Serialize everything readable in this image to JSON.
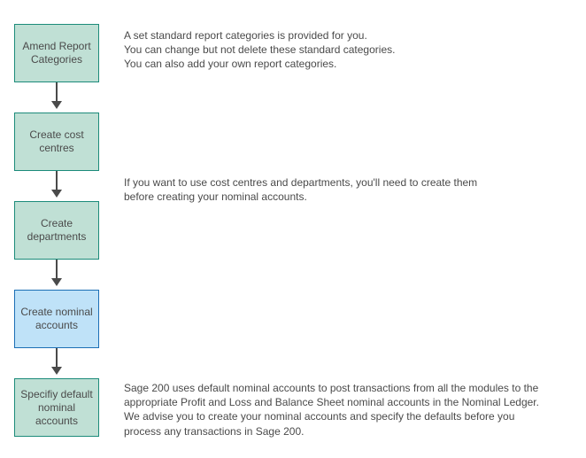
{
  "nodes": {
    "n1": {
      "label": "Amend Report\nCategories"
    },
    "n2": {
      "label": "Create cost\ncentres"
    },
    "n3": {
      "label": "Create\ndepartments"
    },
    "n4": {
      "label": "Create nominal\naccounts"
    },
    "n5": {
      "label": "Specifiy default\nnominal\naccounts"
    }
  },
  "paras": {
    "p1": "A set standard report categories is provided for you.\nYou can change but not delete these standard categories.\nYou can also add your own report categories.",
    "p2": "If you want  to use cost centres and departments, you'll need to create them\nbefore creating your nominal accounts.",
    "p3": "Sage 200 uses default nominal accounts  to post transactions from all the modules to the\nappropriate Profit and Loss and Balance Sheet nominal accounts in the Nominal Ledger.\nWe advise you to create your nominal accounts and specify the defaults before you\nprocess any transactions in Sage 200."
  }
}
